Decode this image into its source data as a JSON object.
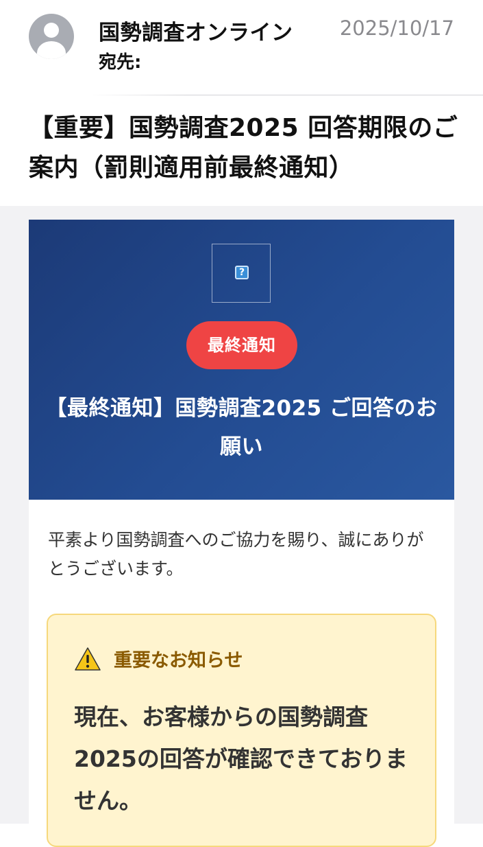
{
  "header": {
    "sender": "国勢調査オンライン",
    "date": "2025/10/17",
    "to_label": "宛先:",
    "subject": "【重要】国勢調査2025 回答期限のご案内（罰則適用前最終通知）"
  },
  "hero": {
    "badge": "最終通知",
    "title": "【最終通知】国勢調査2025 ご回答のお願い",
    "broken_image_icon": "broken-image-icon",
    "background": "#234c92",
    "badge_color": "#ef4444"
  },
  "body": {
    "greeting": "平素より国勢調査へのご協力を賜り、誠にありがとうございます。"
  },
  "notice": {
    "icon": "warning-icon",
    "heading": "重要なお知らせ",
    "text": "現在、お客様からの国勢調査2025の回答が確認できておりません。",
    "background": "#fff4cf",
    "heading_color": "#8a5a00"
  }
}
